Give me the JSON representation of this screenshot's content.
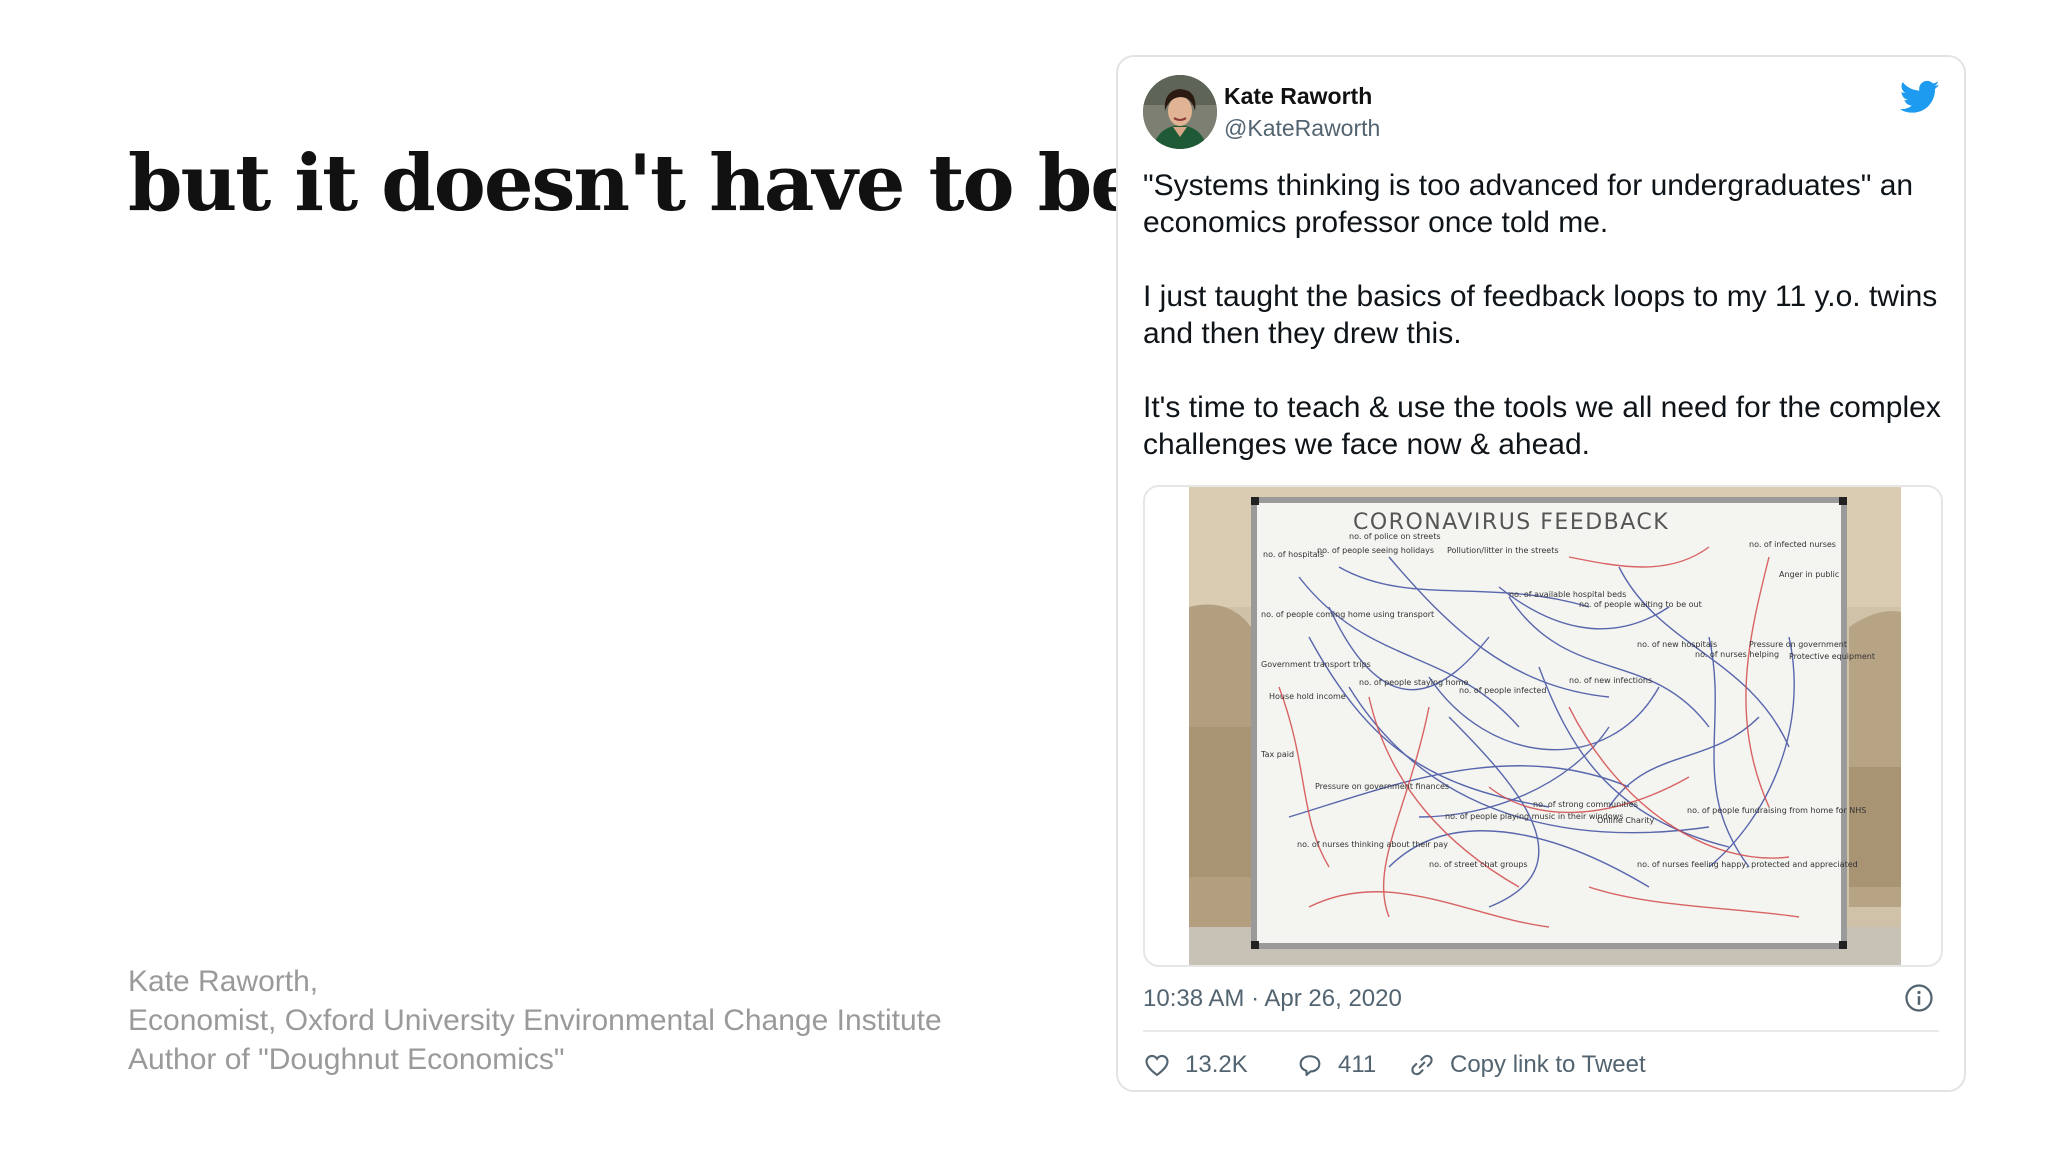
{
  "slide": {
    "title": "but it doesn't have to be.",
    "attribution": [
      "Kate Raworth,",
      "Economist, Oxford University Environmental Change Institute",
      "Author of \"Doughnut Economics\""
    ]
  },
  "tweet": {
    "author_name": "Kate Raworth",
    "author_handle": "@KateRaworth",
    "paragraphs": [
      "\"Systems thinking is too advanced for undergraduates\" an economics professor once told me.",
      "I just taught the basics of feedback loops to my 11 y.o. twins and then they drew this.",
      "It's time to teach & use the tools we all need for the complex challenges we face now & ahead."
    ],
    "timestamp": "10:38 AM · Apr 26, 2020",
    "likes": "13.2K",
    "replies": "411",
    "copy_link_label": "Copy link to Tweet",
    "brand_color": "#1d9bf0",
    "icons": [
      "twitter-bird-icon",
      "info-icon",
      "heart-icon",
      "reply-bubble-icon",
      "link-icon"
    ]
  },
  "whiteboard": {
    "title": "CORONAVIRUS FEEDBACK",
    "notes": [
      "no. of hospitals",
      "no. of people seeing holidays",
      "no. of police on streets",
      "Pollution/litter in the streets",
      "no. of infected nurses",
      "Anger in public",
      "no. of people coming home using transport",
      "no. of available hospital beds",
      "no. of people waiting to be out",
      "no. of new hospitals",
      "no. of nurses helping",
      "Pressure on government",
      "Protective equipment",
      "Government transport trips",
      "House hold income",
      "no. of people staying home",
      "no. of people infected",
      "no. of new infections",
      "Tax paid",
      "Pressure on government finances",
      "no. of people playing music in their windows",
      "no. of strong communities",
      "Online Charity",
      "no. of people fundraising from home for NHS",
      "no. of nurses thinking about their pay",
      "no. of street chat groups",
      "no. of nurses feeling happy, protected and appreciated"
    ]
  }
}
